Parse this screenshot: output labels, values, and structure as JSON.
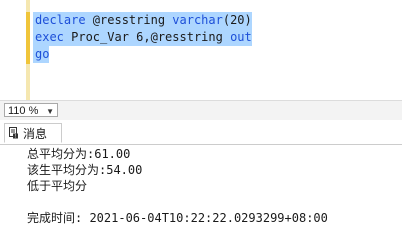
{
  "editor": {
    "lines": [
      {
        "keyword1": "declare",
        "middle": " @resstring ",
        "keyword2": "varchar",
        "rest": "(20)"
      },
      {
        "keyword1": "exec",
        "middle": " Proc_Var 6,@resstring ",
        "keyword2": "out",
        "rest": ""
      },
      {
        "keyword1": "go",
        "middle": "",
        "keyword2": "",
        "rest": ""
      }
    ]
  },
  "zoom": {
    "value": "110 %"
  },
  "results": {
    "tab_label": "消息",
    "messages": [
      "总平均分为:61.00",
      "该生平均分为:54.00",
      "低于平均分",
      "",
      "完成时间: 2021-06-04T10:22:22.0293299+08:00"
    ]
  }
}
